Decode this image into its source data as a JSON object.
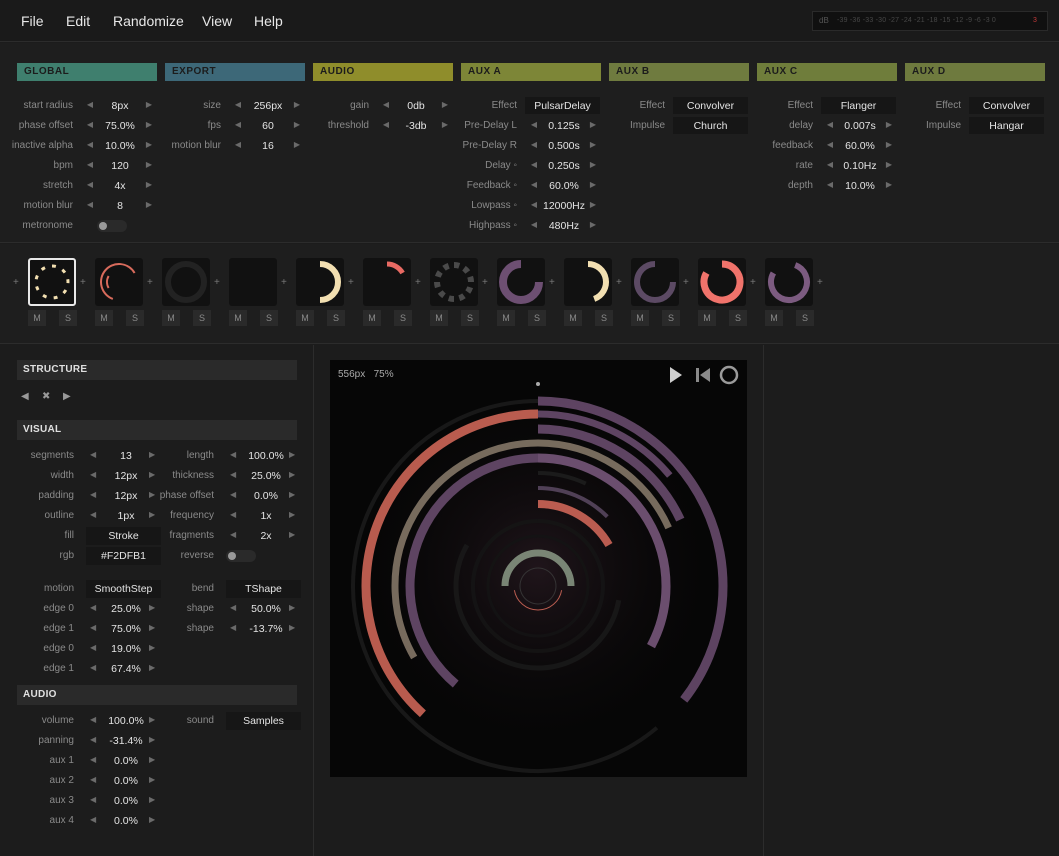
{
  "menu": [
    "File",
    "Edit",
    "Randomize",
    "View",
    "Help"
  ],
  "vu": {
    "label": "dB",
    "ticks": "-39 -36 -33 -30 -27 -24 -21 -18 -15 -12 -9 -6 -3 0",
    "peak": "3"
  },
  "panels": {
    "global": {
      "title": "GLOBAL",
      "color": "#3f7f6e",
      "rows": [
        {
          "label": "start radius",
          "value": "8px"
        },
        {
          "label": "phase offset",
          "value": "75.0%"
        },
        {
          "label": "inactive alpha",
          "value": "10.0%"
        },
        {
          "label": "bpm",
          "value": "120"
        },
        {
          "label": "stretch",
          "value": "4x"
        },
        {
          "label": "motion blur",
          "value": "8"
        }
      ],
      "metronome_label": "metronome"
    },
    "export": {
      "title": "EXPORT",
      "color": "#3d6878",
      "rows": [
        {
          "label": "size",
          "value": "256px"
        },
        {
          "label": "fps",
          "value": "60"
        },
        {
          "label": "motion blur",
          "value": "16"
        }
      ]
    },
    "audio": {
      "title": "AUDIO",
      "color": "#8f8d2b",
      "rows": [
        {
          "label": "gain",
          "value": "0db"
        },
        {
          "label": "threshold",
          "value": "-3db"
        }
      ]
    },
    "aux_a": {
      "title": "AUX A",
      "color": "#7d8637",
      "effect_label": "Effect",
      "effect": "PulsarDelay",
      "rows": [
        {
          "label": "Pre-Delay L",
          "value": "0.125s"
        },
        {
          "label": "Pre-Delay R",
          "value": "0.500s"
        },
        {
          "label": "Delay ◦",
          "value": "0.250s"
        },
        {
          "label": "Feedback ◦",
          "value": "60.0%"
        },
        {
          "label": "Lowpass ◦",
          "value": "12000Hz"
        },
        {
          "label": "Highpass ◦",
          "value": "480Hz"
        }
      ]
    },
    "aux_b": {
      "title": "AUX B",
      "color": "#6f7b3f",
      "effect_label": "Effect",
      "effect": "Convolver",
      "impulse_label": "Impulse",
      "impulse": "Church"
    },
    "aux_c": {
      "title": "AUX C",
      "color": "#6f7d3b",
      "effect_label": "Effect",
      "effect": "Flanger",
      "rows": [
        {
          "label": "delay",
          "value": "0.007s"
        },
        {
          "label": "feedback",
          "value": "60.0%"
        },
        {
          "label": "rate",
          "value": "0.10Hz"
        },
        {
          "label": "depth",
          "value": "10.0%"
        }
      ]
    },
    "aux_d": {
      "title": "AUX D",
      "color": "#6e7a3e",
      "effect_label": "Effect",
      "effect": "Convolver",
      "impulse_label": "Impulse",
      "impulse": "Hangar"
    }
  },
  "tracks": {
    "mute_label": "M",
    "solo_label": "S",
    "add_label": "+",
    "items": [
      {
        "color": "#F2DFB1",
        "selected": true
      },
      {
        "color": "#d86b5c"
      },
      {
        "color": "#8b9a86"
      },
      {
        "color": "#555555"
      },
      {
        "color": "#F2DFB1"
      },
      {
        "color": "#e86a63"
      },
      {
        "color": "#555555"
      },
      {
        "color": "#6d4f72"
      },
      {
        "color": "#F2DFB1"
      },
      {
        "color": "#5c4a64"
      },
      {
        "color": "#f0736b"
      },
      {
        "color": "#7c5b80"
      }
    ]
  },
  "structure": {
    "title": "STRUCTURE",
    "prev": "◀",
    "remove": "✖",
    "next": "▶"
  },
  "visual": {
    "title": "VISUAL",
    "left": [
      {
        "label": "segments",
        "value": "13"
      },
      {
        "label": "width",
        "value": "12px"
      },
      {
        "label": "padding",
        "value": "12px"
      },
      {
        "label": "outline",
        "value": "1px"
      }
    ],
    "fill_label": "fill",
    "fill": "Stroke",
    "rgb_label": "rgb",
    "rgb": "#F2DFB1",
    "right": [
      {
        "label": "length",
        "value": "100.0%"
      },
      {
        "label": "thickness",
        "value": "25.0%"
      },
      {
        "label": "phase offset",
        "value": "0.0%"
      },
      {
        "label": "frequency",
        "value": "1x"
      },
      {
        "label": "fragments",
        "value": "2x"
      }
    ],
    "reverse_label": "reverse",
    "motion_label": "motion",
    "motion": "SmoothStep",
    "bend_label": "bend",
    "bend": "TShape",
    "motion_rows": [
      {
        "label": "edge 0",
        "value": "25.0%"
      },
      {
        "label": "edge 1",
        "value": "75.0%"
      },
      {
        "label": "edge 0",
        "value": "19.0%"
      },
      {
        "label": "edge 1",
        "value": "67.4%"
      }
    ],
    "bend_rows": [
      {
        "label": "shape",
        "value": "50.0%"
      },
      {
        "label": "shape",
        "value": "-13.7%"
      }
    ]
  },
  "audio_track": {
    "title": "AUDIO",
    "rows": [
      {
        "label": "volume",
        "value": "100.0%"
      },
      {
        "label": "panning",
        "value": "-31.4%"
      },
      {
        "label": "aux 1",
        "value": "0.0%"
      },
      {
        "label": "aux 2",
        "value": "0.0%"
      },
      {
        "label": "aux 3",
        "value": "0.0%"
      },
      {
        "label": "aux 4",
        "value": "0.0%"
      }
    ],
    "sound_label": "sound",
    "sound": "Samples"
  },
  "canvas": {
    "size": "556px",
    "zoom": "75%"
  }
}
